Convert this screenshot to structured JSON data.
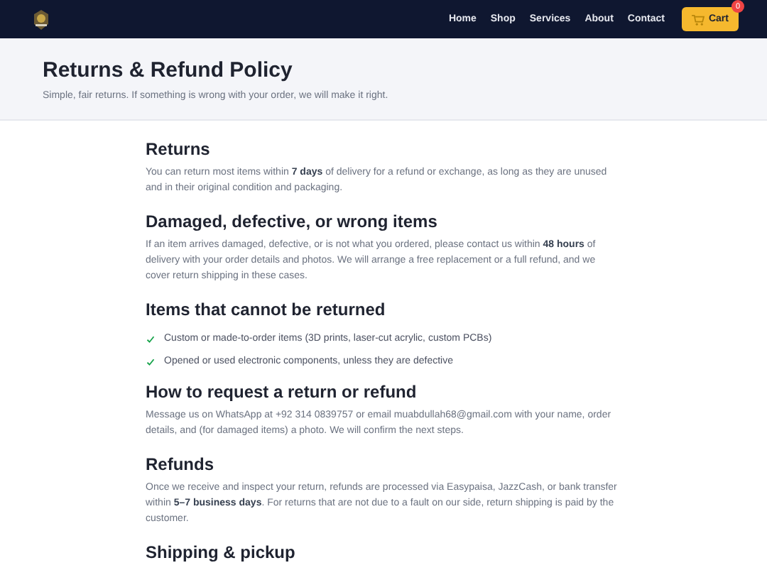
{
  "nav": {
    "links": [
      "Home",
      "Shop",
      "Services",
      "About",
      "Contact"
    ],
    "cart": {
      "label": "Cart",
      "count": "0"
    }
  },
  "hero": {
    "title": "Returns & Refund Policy",
    "subtitle": "Simple, fair returns. If something is wrong with your order, we will make it right."
  },
  "sections": [
    {
      "heading": "Returns",
      "kind": "paragraph",
      "text": "You can return most items within **7 days** of delivery for a refund or exchange, as long as they are unused and in their original condition and packaging."
    },
    {
      "heading": "Damaged, defective, or wrong items",
      "kind": "paragraph",
      "text": "If an item arrives damaged, defective, or is not what you ordered, please contact us within **48 hours** of delivery with your order details and photos. We will arrange a free replacement or a full refund, and we cover return shipping in these cases."
    },
    {
      "heading": "Items that cannot be returned",
      "kind": "list",
      "items": [
        "Custom or made-to-order items (3D prints, laser-cut acrylic, custom PCBs)",
        "Opened or used electronic components, unless they are defective"
      ]
    },
    {
      "heading": "How to request a return or refund",
      "kind": "paragraph",
      "text": "Message us on WhatsApp at +92 314 0839757 or email muabdullah68@gmail.com with your name, order details, and (for damaged items) a photo. We will confirm the next steps."
    },
    {
      "heading": "Refunds",
      "kind": "paragraph",
      "text": "Once we receive and inspect your return, refunds are processed via Easypaisa, JazzCash, or bank transfer within **5–7 business days**. For returns that are not due to a fault on our side, return shipping is paid by the customer."
    },
    {
      "heading": "Shipping & pickup",
      "kind": "heading-only"
    }
  ]
}
